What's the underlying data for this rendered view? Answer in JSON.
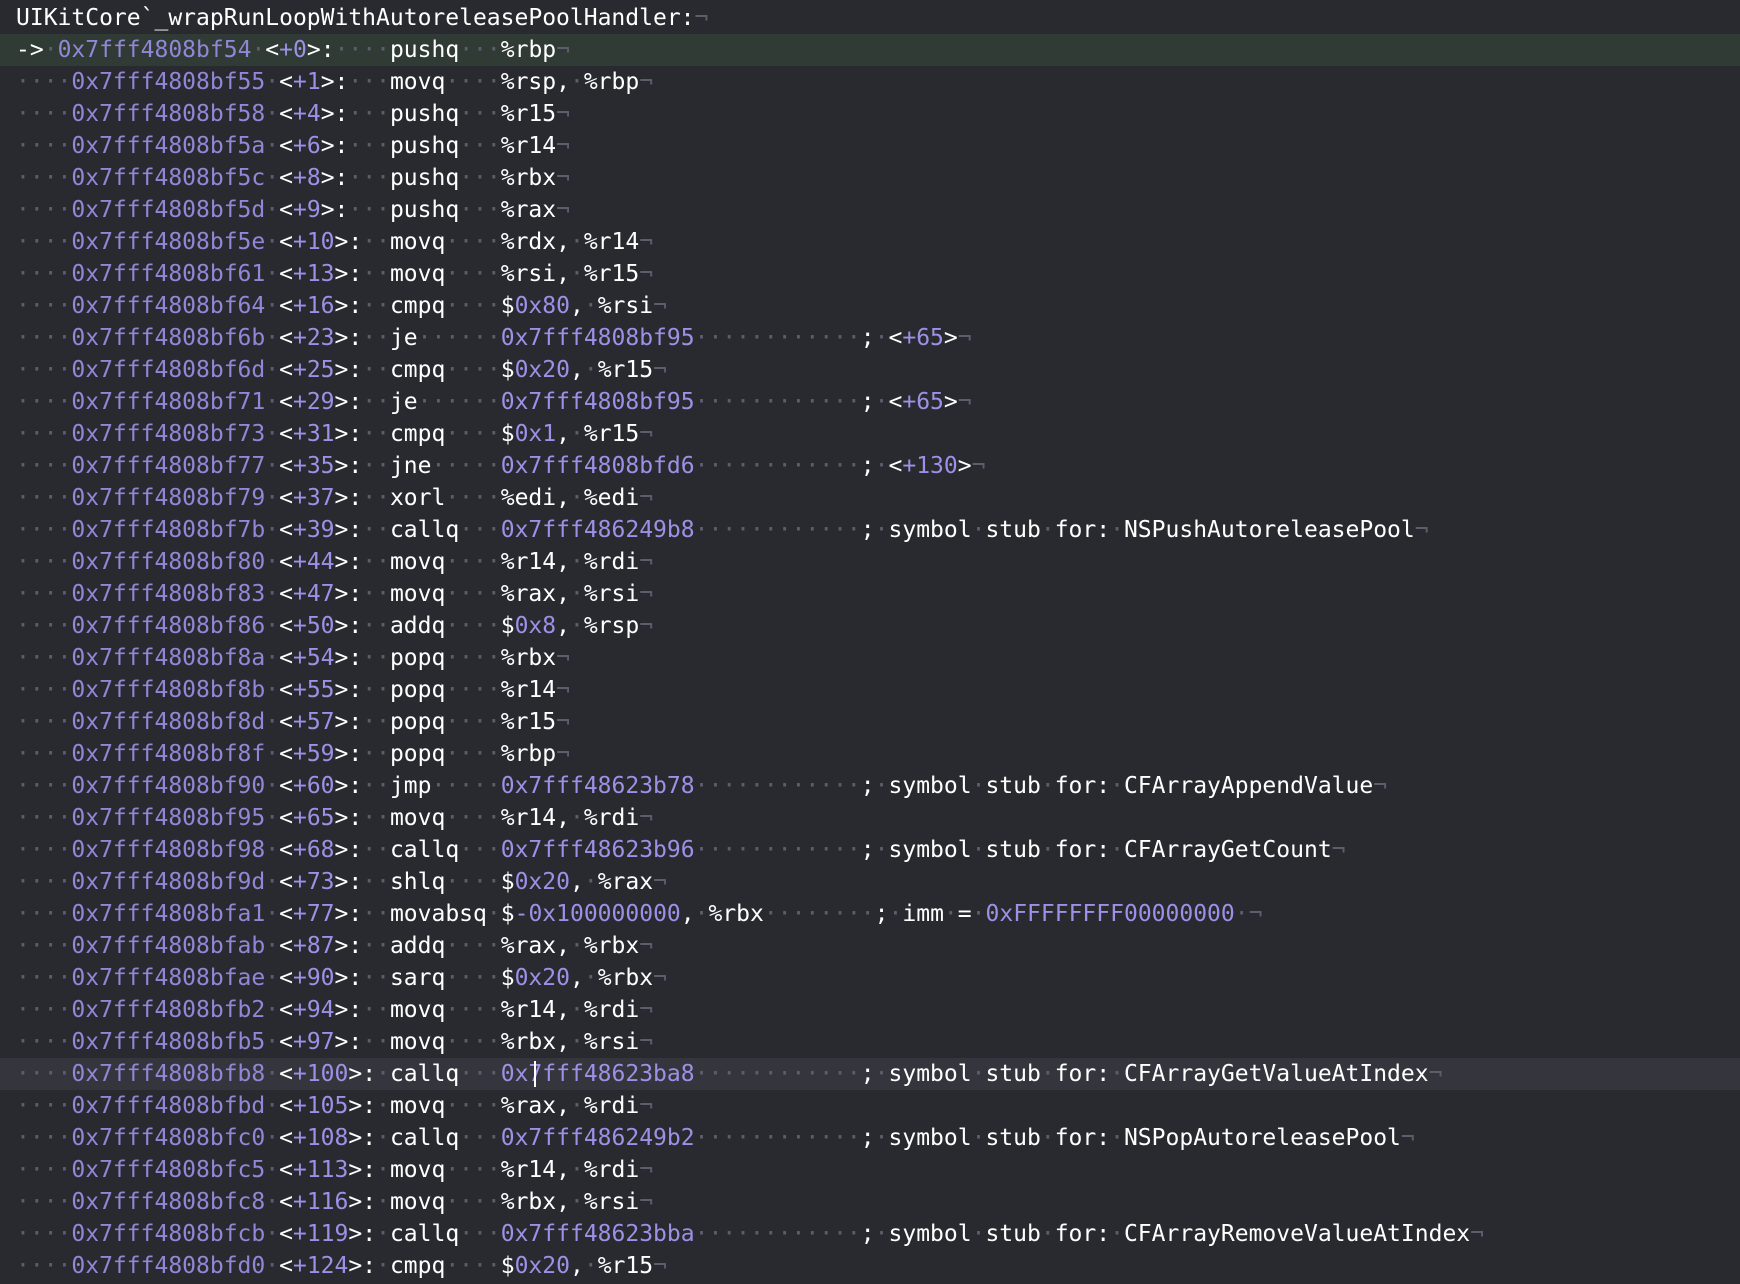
{
  "title": "UIKitCore`_wrapRunLoopWithAutoreleasePoolHandler:",
  "current_marker": "->",
  "lines": [
    {
      "addr": "0x7fff4808bf54",
      "off": "+0",
      "m": "pushq",
      "ops": [
        [
          "r",
          "%rbp"
        ]
      ],
      "cur": true
    },
    {
      "addr": "0x7fff4808bf55",
      "off": "+1",
      "m": "movq",
      "ops": [
        [
          "r",
          "%rsp, %rbp"
        ]
      ]
    },
    {
      "addr": "0x7fff4808bf58",
      "off": "+4",
      "m": "pushq",
      "ops": [
        [
          "r",
          "%r15"
        ]
      ]
    },
    {
      "addr": "0x7fff4808bf5a",
      "off": "+6",
      "m": "pushq",
      "ops": [
        [
          "r",
          "%r14"
        ]
      ]
    },
    {
      "addr": "0x7fff4808bf5c",
      "off": "+8",
      "m": "pushq",
      "ops": [
        [
          "r",
          "%rbx"
        ]
      ]
    },
    {
      "addr": "0x7fff4808bf5d",
      "off": "+9",
      "m": "pushq",
      "ops": [
        [
          "r",
          "%rax"
        ]
      ]
    },
    {
      "addr": "0x7fff4808bf5e",
      "off": "+10",
      "m": "movq",
      "ops": [
        [
          "r",
          "%rdx, %r14"
        ]
      ]
    },
    {
      "addr": "0x7fff4808bf61",
      "off": "+13",
      "m": "movq",
      "ops": [
        [
          "r",
          "%rsi, %r15"
        ]
      ]
    },
    {
      "addr": "0x7fff4808bf64",
      "off": "+16",
      "m": "cmpq",
      "ops": [
        [
          "r",
          "$"
        ],
        [
          "n",
          "0x80"
        ],
        [
          "r",
          ", %rsi"
        ]
      ]
    },
    {
      "addr": "0x7fff4808bf6b",
      "off": "+23",
      "m": "je",
      "ops": [
        [
          "n",
          "0x7fff4808bf95"
        ]
      ],
      "cmt": [
        [
          "c",
          "; <"
        ],
        [
          "n",
          "+65"
        ],
        [
          "c",
          ">"
        ]
      ]
    },
    {
      "addr": "0x7fff4808bf6d",
      "off": "+25",
      "m": "cmpq",
      "ops": [
        [
          "r",
          "$"
        ],
        [
          "n",
          "0x20"
        ],
        [
          "r",
          ", %r15"
        ]
      ]
    },
    {
      "addr": "0x7fff4808bf71",
      "off": "+29",
      "m": "je",
      "ops": [
        [
          "n",
          "0x7fff4808bf95"
        ]
      ],
      "cmt": [
        [
          "c",
          "; <"
        ],
        [
          "n",
          "+65"
        ],
        [
          "c",
          ">"
        ]
      ]
    },
    {
      "addr": "0x7fff4808bf73",
      "off": "+31",
      "m": "cmpq",
      "ops": [
        [
          "r",
          "$"
        ],
        [
          "n",
          "0x1"
        ],
        [
          "r",
          ", %r15"
        ]
      ]
    },
    {
      "addr": "0x7fff4808bf77",
      "off": "+35",
      "m": "jne",
      "ops": [
        [
          "n",
          "0x7fff4808bfd6"
        ]
      ],
      "cmt": [
        [
          "c",
          "; <"
        ],
        [
          "n",
          "+130"
        ],
        [
          "c",
          ">"
        ]
      ]
    },
    {
      "addr": "0x7fff4808bf79",
      "off": "+37",
      "m": "xorl",
      "ops": [
        [
          "r",
          "%edi, %edi"
        ]
      ]
    },
    {
      "addr": "0x7fff4808bf7b",
      "off": "+39",
      "m": "callq",
      "ops": [
        [
          "n",
          "0x7fff486249b8"
        ]
      ],
      "cmt": [
        [
          "c",
          "; symbol stub for: NSPushAutoreleasePool"
        ]
      ]
    },
    {
      "addr": "0x7fff4808bf80",
      "off": "+44",
      "m": "movq",
      "ops": [
        [
          "r",
          "%r14, %rdi"
        ]
      ]
    },
    {
      "addr": "0x7fff4808bf83",
      "off": "+47",
      "m": "movq",
      "ops": [
        [
          "r",
          "%rax, %rsi"
        ]
      ]
    },
    {
      "addr": "0x7fff4808bf86",
      "off": "+50",
      "m": "addq",
      "ops": [
        [
          "r",
          "$"
        ],
        [
          "n",
          "0x8"
        ],
        [
          "r",
          ", %rsp"
        ]
      ]
    },
    {
      "addr": "0x7fff4808bf8a",
      "off": "+54",
      "m": "popq",
      "ops": [
        [
          "r",
          "%rbx"
        ]
      ]
    },
    {
      "addr": "0x7fff4808bf8b",
      "off": "+55",
      "m": "popq",
      "ops": [
        [
          "r",
          "%r14"
        ]
      ]
    },
    {
      "addr": "0x7fff4808bf8d",
      "off": "+57",
      "m": "popq",
      "ops": [
        [
          "r",
          "%r15"
        ]
      ]
    },
    {
      "addr": "0x7fff4808bf8f",
      "off": "+59",
      "m": "popq",
      "ops": [
        [
          "r",
          "%rbp"
        ]
      ]
    },
    {
      "addr": "0x7fff4808bf90",
      "off": "+60",
      "m": "jmp",
      "ops": [
        [
          "n",
          "0x7fff48623b78"
        ]
      ],
      "cmt": [
        [
          "c",
          "; symbol stub for: CFArrayAppendValue"
        ]
      ]
    },
    {
      "addr": "0x7fff4808bf95",
      "off": "+65",
      "m": "movq",
      "ops": [
        [
          "r",
          "%r14, %rdi"
        ]
      ]
    },
    {
      "addr": "0x7fff4808bf98",
      "off": "+68",
      "m": "callq",
      "ops": [
        [
          "n",
          "0x7fff48623b96"
        ]
      ],
      "cmt": [
        [
          "c",
          "; symbol stub for: CFArrayGetCount"
        ]
      ]
    },
    {
      "addr": "0x7fff4808bf9d",
      "off": "+73",
      "m": "shlq",
      "ops": [
        [
          "r",
          "$"
        ],
        [
          "n",
          "0x20"
        ],
        [
          "r",
          ", %rax"
        ]
      ]
    },
    {
      "addr": "0x7fff4808bfa1",
      "off": "+77",
      "m": "movabsq",
      "ops": [
        [
          "r",
          "$"
        ],
        [
          "n",
          "-0x100000000"
        ],
        [
          "r",
          ", %rbx"
        ]
      ],
      "cmt": [
        [
          "c",
          "; imm = "
        ],
        [
          "n",
          "0xFFFFFFFF00000000"
        ],
        [
          "c",
          " "
        ]
      ]
    },
    {
      "addr": "0x7fff4808bfab",
      "off": "+87",
      "m": "addq",
      "ops": [
        [
          "r",
          "%rax, %rbx"
        ]
      ]
    },
    {
      "addr": "0x7fff4808bfae",
      "off": "+90",
      "m": "sarq",
      "ops": [
        [
          "r",
          "$"
        ],
        [
          "n",
          "0x20"
        ],
        [
          "r",
          ", %rbx"
        ]
      ]
    },
    {
      "addr": "0x7fff4808bfb2",
      "off": "+94",
      "m": "movq",
      "ops": [
        [
          "r",
          "%r14, %rdi"
        ]
      ]
    },
    {
      "addr": "0x7fff4808bfb5",
      "off": "+97",
      "m": "movq",
      "ops": [
        [
          "r",
          "%rbx, %rsi"
        ]
      ]
    },
    {
      "addr": "0x7fff4808bfb8",
      "off": "+100",
      "m": "callq",
      "ops": [
        [
          "n",
          "0x7fff48623ba8"
        ]
      ],
      "cmt": [
        [
          "c",
          "; symbol stub for: CFArrayGetValueAtIndex"
        ]
      ],
      "hl": true
    },
    {
      "addr": "0x7fff4808bfbd",
      "off": "+105",
      "m": "movq",
      "ops": [
        [
          "r",
          "%rax, %rdi"
        ]
      ]
    },
    {
      "addr": "0x7fff4808bfc0",
      "off": "+108",
      "m": "callq",
      "ops": [
        [
          "n",
          "0x7fff486249b2"
        ]
      ],
      "cmt": [
        [
          "c",
          "; symbol stub for: NSPopAutoreleasePool"
        ]
      ]
    },
    {
      "addr": "0x7fff4808bfc5",
      "off": "+113",
      "m": "movq",
      "ops": [
        [
          "r",
          "%r14, %rdi"
        ]
      ]
    },
    {
      "addr": "0x7fff4808bfc8",
      "off": "+116",
      "m": "movq",
      "ops": [
        [
          "r",
          "%rbx, %rsi"
        ]
      ]
    },
    {
      "addr": "0x7fff4808bfcb",
      "off": "+119",
      "m": "callq",
      "ops": [
        [
          "n",
          "0x7fff48623bba"
        ]
      ],
      "cmt": [
        [
          "c",
          "; symbol stub for: CFArrayRemoveValueAtIndex"
        ]
      ]
    },
    {
      "addr": "0x7fff4808bfd0",
      "off": "+124",
      "m": "cmpq",
      "ops": [
        [
          "r",
          "$"
        ],
        [
          "n",
          "0x20"
        ],
        [
          "r",
          ", %r15"
        ]
      ]
    }
  ],
  "colors": {
    "background": "#292a30",
    "current_line": "#2f3b34",
    "highlight_line": "#35363d",
    "address": "#9286d6",
    "number": "#9d90e6",
    "whitespace_marker": "#5c5f6b",
    "text": "#ffffff"
  }
}
